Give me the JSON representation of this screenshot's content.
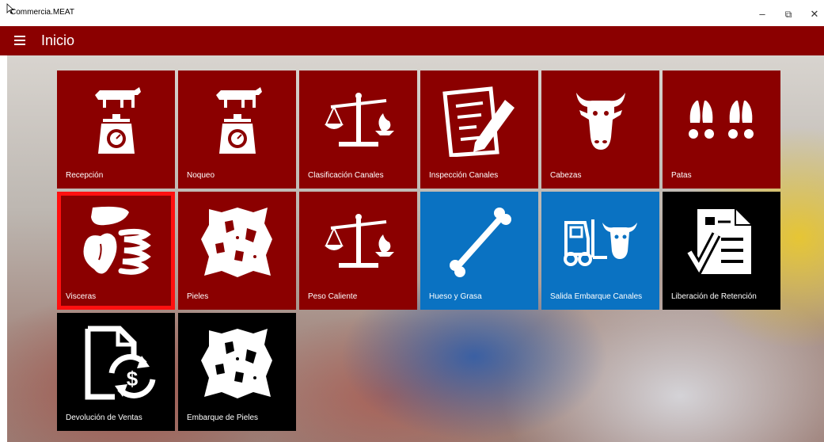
{
  "window": {
    "title": "Commercia.MEAT",
    "minimize_glyph": "–",
    "restore_glyph": "⧉",
    "close_glyph": "✕"
  },
  "header": {
    "title": "Inicio",
    "menu_icon": "hamburger-icon"
  },
  "tiles": [
    {
      "label": "Recepción",
      "icon": "cow-scale-icon",
      "color": "#8b0000"
    },
    {
      "label": "Noqueo",
      "icon": "cow-scale-icon",
      "color": "#8b0000"
    },
    {
      "label": "Clasificación Canales",
      "icon": "balance-flame-icon",
      "color": "#8b0000"
    },
    {
      "label": "Inspección Canales",
      "icon": "document-pencil-icon",
      "color": "#8b0000"
    },
    {
      "label": "Cabezas",
      "icon": "cow-head-icon",
      "color": "#8b0000"
    },
    {
      "label": "Patas",
      "icon": "hooves-icon",
      "color": "#8b0000"
    },
    {
      "label": "Visceras",
      "icon": "organs-icon",
      "color": "#8b0000",
      "selected": true
    },
    {
      "label": "Pieles",
      "icon": "hide-icon",
      "color": "#8b0000"
    },
    {
      "label": "Peso Caliente",
      "icon": "balance-flame-icon",
      "color": "#8b0000"
    },
    {
      "label": "Hueso y Grasa",
      "icon": "bone-icon",
      "color": "#0a72c2"
    },
    {
      "label": "Salida Embarque Canales",
      "icon": "forklift-cow-icon",
      "color": "#0a72c2"
    },
    {
      "label": "Liberación de Retención",
      "icon": "checklist-document-icon",
      "color": "#000000"
    },
    {
      "label": "Devolución de Ventas",
      "icon": "document-refund-icon",
      "color": "#000000"
    },
    {
      "label": "Embarque de Pieles",
      "icon": "hide-icon",
      "color": "#000000"
    }
  ]
}
